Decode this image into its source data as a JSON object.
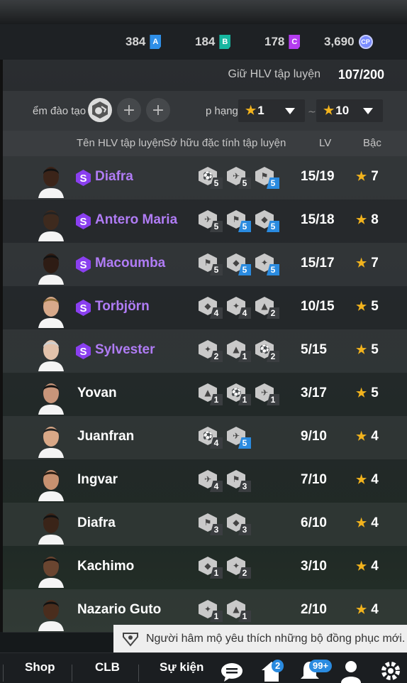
{
  "currencies": [
    {
      "value": "384",
      "badge": "A",
      "color": "#2f8fe8"
    },
    {
      "value": "184",
      "badge": "B",
      "color": "#17b7a0"
    },
    {
      "value": "178",
      "badge": "C",
      "color": "#b43cf0"
    },
    {
      "value": "3,690",
      "badge": "CP",
      "color": "#7a8cff"
    }
  ],
  "hold": {
    "label": "Giữ HLV tập luyện",
    "value": "107/200"
  },
  "filter": {
    "training_label": "ểm đào tạo",
    "rank_label": "p hạng",
    "min_rank": "1",
    "max_rank": "10",
    "separator": "~"
  },
  "headers": {
    "name": "Tên HLV tập luyện",
    "traits": "Sở hữu đặc tính tập luyện",
    "lv": "LV",
    "rank": "Bậc"
  },
  "coaches": [
    {
      "name": "Diafra",
      "special": true,
      "lv": "15/19",
      "rank": "7",
      "traits": [
        [
          "5",
          false
        ],
        [
          "5",
          false
        ],
        [
          "5",
          true
        ]
      ]
    },
    {
      "name": "Antero Maria",
      "special": true,
      "lv": "15/18",
      "rank": "8",
      "traits": [
        [
          "5",
          false
        ],
        [
          "5",
          true
        ],
        [
          "5",
          true
        ]
      ]
    },
    {
      "name": "Macoumba",
      "special": true,
      "lv": "15/17",
      "rank": "7",
      "traits": [
        [
          "5",
          false
        ],
        [
          "5",
          true
        ],
        [
          "5",
          true
        ]
      ]
    },
    {
      "name": "Torbjörn",
      "special": true,
      "lv": "10/15",
      "rank": "5",
      "traits": [
        [
          "4",
          false
        ],
        [
          "4",
          false
        ],
        [
          "2",
          false
        ]
      ]
    },
    {
      "name": "Sylvester",
      "special": true,
      "lv": "5/15",
      "rank": "5",
      "traits": [
        [
          "2",
          false
        ],
        [
          "1",
          false
        ],
        [
          "2",
          false
        ]
      ]
    },
    {
      "name": "Yovan",
      "special": false,
      "lv": "3/17",
      "rank": "5",
      "traits": [
        [
          "1",
          false
        ],
        [
          "1",
          false
        ],
        [
          "1",
          false
        ]
      ]
    },
    {
      "name": "Juanfran",
      "special": false,
      "lv": "9/10",
      "rank": "4",
      "traits": [
        [
          "4",
          false
        ],
        [
          "5",
          true
        ]
      ]
    },
    {
      "name": "Ingvar",
      "special": false,
      "lv": "7/10",
      "rank": "4",
      "traits": [
        [
          "4",
          false
        ],
        [
          "3",
          false
        ]
      ]
    },
    {
      "name": "Diafra",
      "special": false,
      "lv": "6/10",
      "rank": "4",
      "traits": [
        [
          "3",
          false
        ],
        [
          "3",
          false
        ]
      ]
    },
    {
      "name": "Kachimo",
      "special": false,
      "lv": "3/10",
      "rank": "4",
      "traits": [
        [
          "1",
          false
        ],
        [
          "2",
          false
        ]
      ]
    },
    {
      "name": "Nazario Guto",
      "special": false,
      "lv": "2/10",
      "rank": "4",
      "traits": [
        [
          "1",
          false
        ],
        [
          "1",
          false
        ]
      ]
    }
  ],
  "toast": "Người hâm mộ yêu thích những bộ đồng phục mới.",
  "nav": {
    "shop": "Shop",
    "club": "CLB",
    "events": "Sự kiện",
    "home_badge": "2",
    "notif_badge": "99+"
  },
  "colors": {
    "special_name": "#b07cf5",
    "star": "#f2b31d",
    "blue_level": "#2a8be0"
  }
}
